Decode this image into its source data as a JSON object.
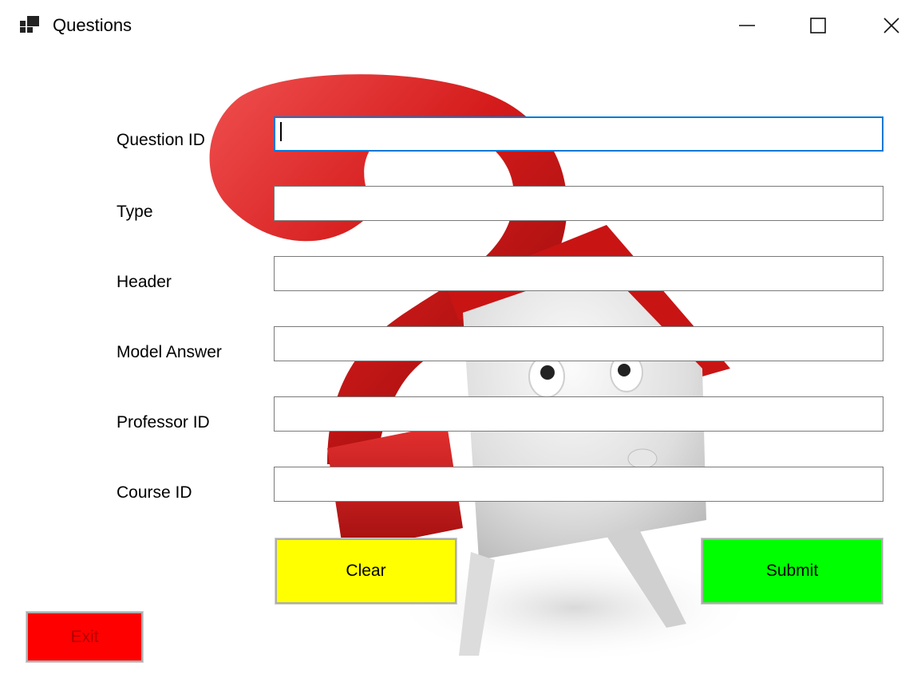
{
  "window": {
    "title": "Questions",
    "controls": {
      "minimize_icon": "minimize-icon",
      "maximize_icon": "maximize-icon",
      "close_icon": "close-icon"
    }
  },
  "form": {
    "fields": [
      {
        "label": "Question ID",
        "value": "",
        "focused": true
      },
      {
        "label": "Type",
        "value": ""
      },
      {
        "label": "Header",
        "value": ""
      },
      {
        "label": "Model Answer",
        "value": ""
      },
      {
        "label": "Professor ID",
        "value": ""
      },
      {
        "label": "Course ID",
        "value": ""
      }
    ],
    "buttons": {
      "clear_label": "Clear",
      "submit_label": "Submit",
      "exit_label": "Exit"
    }
  },
  "colors": {
    "clear_button": "#ffff00",
    "submit_button": "#00ff00",
    "exit_button": "#ff0000",
    "focus_border": "#0078d7",
    "background_art_red": "#d41a1a"
  },
  "background_art": "question-mark-house-figure-image"
}
